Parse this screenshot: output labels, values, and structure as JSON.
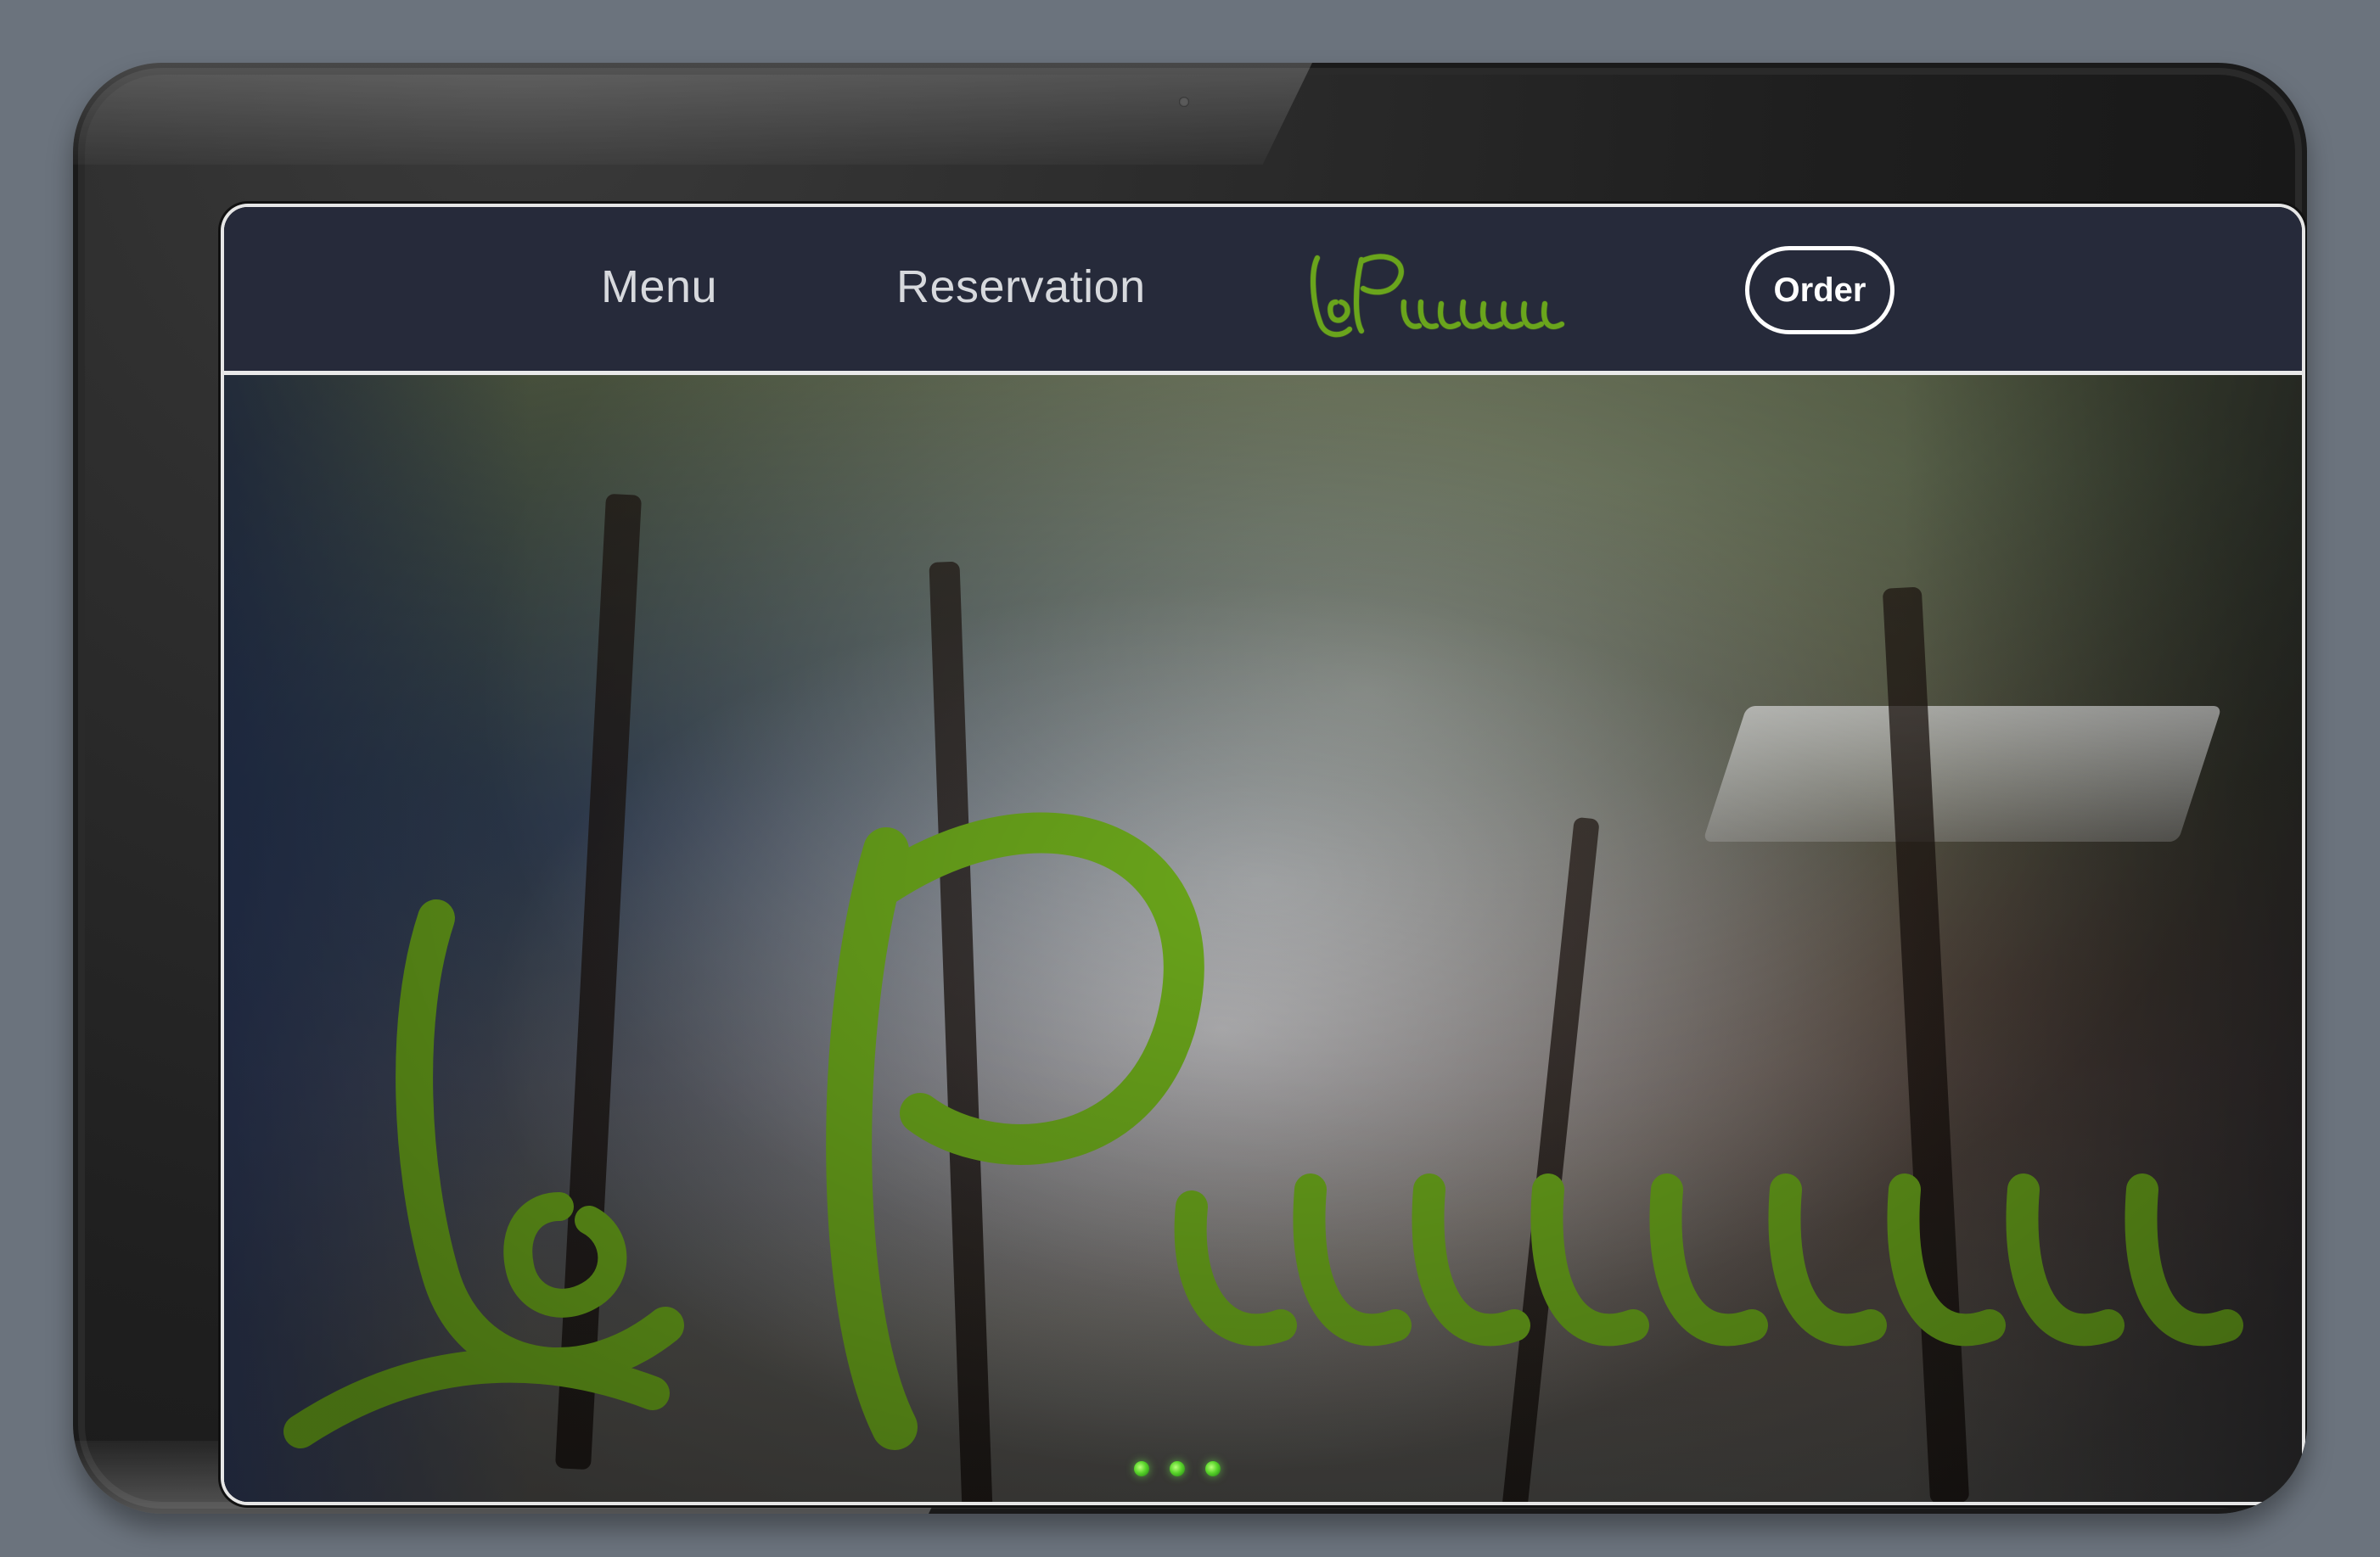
{
  "nav": {
    "menu_label": "Menu",
    "reservation_label": "Reservation",
    "order_label": "Order"
  },
  "brand": {
    "name": "La Primavera",
    "accent_color": "#6aa51b"
  },
  "ui": {
    "topbar_color": "#262a3a",
    "nav_text_color": "#d7d9dd",
    "order_button_color": "#ffffff"
  },
  "icons": {
    "device_camera": "camera-dot",
    "device_status": "status-dots"
  }
}
